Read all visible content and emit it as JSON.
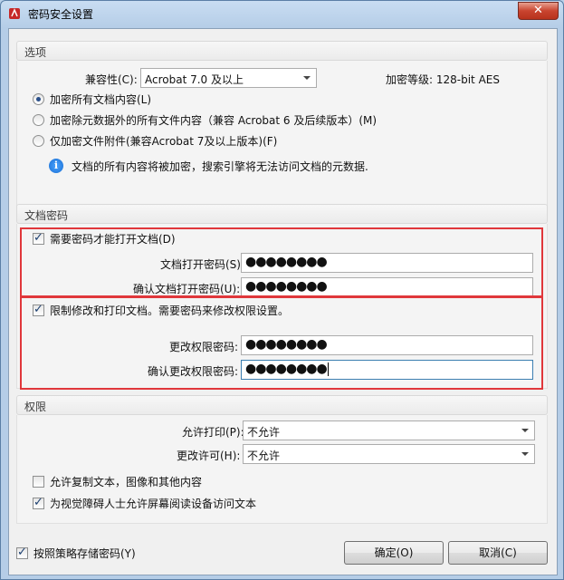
{
  "window": {
    "title": "密码安全设置",
    "close_glyph": "✕"
  },
  "options": {
    "header": "选项",
    "compat_label": "兼容性(C):",
    "compat_value": "Acrobat 7.0 及以上",
    "encrypt_level": "加密等级: 128-bit AES",
    "radios": [
      {
        "label": "加密所有文档内容(L)",
        "selected": true
      },
      {
        "label": "加密除元数据外的所有文件内容（兼容 Acrobat 6 及后续版本）(M)",
        "selected": false
      },
      {
        "label": "仅加密文件附件(兼容Acrobat 7及以上版本)(F)",
        "selected": false
      }
    ],
    "info_icon": "i",
    "info_text": "文档的所有内容将被加密，搜索引擎将无法访问文档的元数据."
  },
  "doc_password": {
    "header": "文档密码",
    "require_label": "需要密码才能打开文档(D)",
    "require_checked": true,
    "open_label": "文档打开密码(S):",
    "open_value": "●●●●●●●●",
    "confirm_label": "确认文档打开密码(U):",
    "confirm_value": "●●●●●●●●",
    "restrict_label": "限制修改和打印文档。需要密码来修改权限设置。",
    "restrict_checked": true,
    "change_label": "更改权限密码:",
    "change_value": "●●●●●●●●",
    "confirm_change_label": "确认更改权限密码:",
    "confirm_change_value": "●●●●●●●●"
  },
  "permissions": {
    "header": "权限",
    "print_label": "允许打印(P):",
    "print_value": "不允许",
    "change_label": "更改许可(H):",
    "change_value": "不允许",
    "copy_label": "允许复制文本，图像和其他内容",
    "copy_checked": false,
    "access_label": "为视觉障碍人士允许屏幕阅读设备访问文本",
    "access_checked": true
  },
  "footer": {
    "store_label": "按照策略存储密码(Y)",
    "store_checked": true,
    "ok": "确定(O)",
    "cancel": "取消(C)"
  },
  "colors": {
    "highlight": "#e0373b",
    "title_bar": "#b5cde7"
  }
}
